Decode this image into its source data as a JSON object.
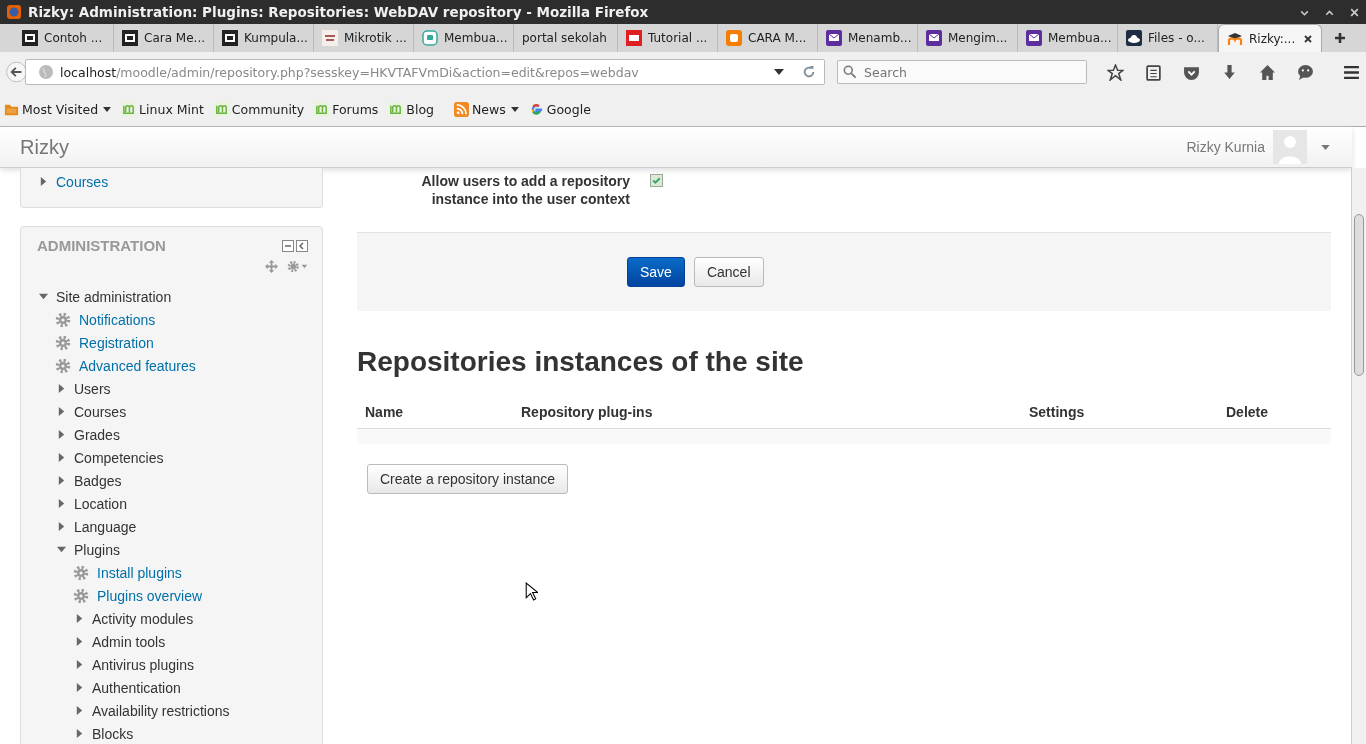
{
  "window": {
    "title": "Rizky: Administration: Plugins: Repositories: WebDAV repository - Mozilla Firefox"
  },
  "tabs": [
    {
      "label": "Contoh ...",
      "kind": "mi",
      "selected": false
    },
    {
      "label": "Cara Me...",
      "kind": "mi",
      "selected": false
    },
    {
      "label": "Kumpula...",
      "kind": "mi",
      "selected": false
    },
    {
      "label": "Mikrotik ...",
      "kind": "mikrotik",
      "selected": false
    },
    {
      "label": "Membua...",
      "kind": "blog",
      "selected": false
    },
    {
      "label": "portal sekolah",
      "kind": "plain",
      "selected": false
    },
    {
      "label": "Tutorial ...",
      "kind": "sk",
      "selected": false
    },
    {
      "label": "CARA M...",
      "kind": "blogger",
      "selected": false
    },
    {
      "label": "Menamb...",
      "kind": "mail",
      "selected": false
    },
    {
      "label": "Mengim...",
      "kind": "mail",
      "selected": false
    },
    {
      "label": "Membua...",
      "kind": "mail",
      "selected": false
    },
    {
      "label": "Files - o...",
      "kind": "cloud",
      "selected": false
    },
    {
      "label": "Rizky:...",
      "kind": "moodle",
      "selected": true
    }
  ],
  "address": {
    "host": "localhost",
    "path": "/moodle/admin/repository.php?sesskey=HKVTAFVmDi&action=edit&repos=webdav"
  },
  "search": {
    "placeholder": "Search"
  },
  "bookmarks": [
    {
      "label": "Most Visited",
      "kind": "folder",
      "menu": true
    },
    {
      "label": "Linux Mint",
      "kind": "mint",
      "menu": false
    },
    {
      "label": "Community",
      "kind": "mint",
      "menu": false
    },
    {
      "label": "Forums",
      "kind": "mint",
      "menu": false
    },
    {
      "label": "Blog",
      "kind": "mint",
      "menu": false
    },
    {
      "label": "News",
      "kind": "rss",
      "menu": true
    },
    {
      "label": "Google",
      "kind": "google",
      "menu": false
    }
  ],
  "site": {
    "brand": "Rizky",
    "user": "Rizky Kurnia"
  },
  "sidebar": {
    "courses": {
      "label": "Courses",
      "expanded": false
    },
    "admin_title": "ADMINISTRATION",
    "tree": [
      {
        "label": "Site administration",
        "kind": "folder",
        "expanded": true,
        "children": [
          {
            "label": "Notifications",
            "kind": "link"
          },
          {
            "label": "Registration",
            "kind": "link"
          },
          {
            "label": "Advanced features",
            "kind": "link"
          },
          {
            "label": "Users",
            "kind": "folder",
            "expanded": false
          },
          {
            "label": "Courses",
            "kind": "folder",
            "expanded": false
          },
          {
            "label": "Grades",
            "kind": "folder",
            "expanded": false
          },
          {
            "label": "Competencies",
            "kind": "folder",
            "expanded": false
          },
          {
            "label": "Badges",
            "kind": "folder",
            "expanded": false
          },
          {
            "label": "Location",
            "kind": "folder",
            "expanded": false
          },
          {
            "label": "Language",
            "kind": "folder",
            "expanded": false
          },
          {
            "label": "Plugins",
            "kind": "folder",
            "expanded": true,
            "children": [
              {
                "label": "Install plugins",
                "kind": "link"
              },
              {
                "label": "Plugins overview",
                "kind": "link"
              },
              {
                "label": "Activity modules",
                "kind": "folder",
                "expanded": false
              },
              {
                "label": "Admin tools",
                "kind": "folder",
                "expanded": false
              },
              {
                "label": "Antivirus plugins",
                "kind": "folder",
                "expanded": false
              },
              {
                "label": "Authentication",
                "kind": "folder",
                "expanded": false
              },
              {
                "label": "Availability restrictions",
                "kind": "folder",
                "expanded": false
              },
              {
                "label": "Blocks",
                "kind": "folder",
                "expanded": false
              }
            ]
          }
        ]
      }
    ]
  },
  "form": {
    "option_label": "Allow users to add a repository instance into the user context",
    "option_checked": true,
    "buttons": [
      {
        "label": "Save",
        "primary": true
      },
      {
        "label": "Cancel",
        "primary": false
      }
    ]
  },
  "instances": {
    "heading": "Repositories instances of the site",
    "columns": [
      "Name",
      "Repository plug-ins",
      "Settings",
      "Delete"
    ],
    "create_button": "Create a repository instance"
  }
}
